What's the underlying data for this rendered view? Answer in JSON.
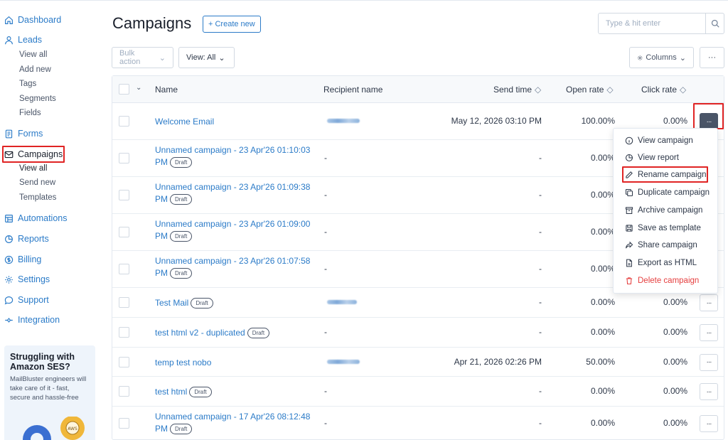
{
  "sidebar": {
    "nav": {
      "dashboard": "Dashboard",
      "leads": "Leads",
      "forms": "Forms",
      "campaigns": "Campaigns",
      "automations": "Automations",
      "reports": "Reports",
      "billing": "Billing",
      "settings": "Settings",
      "support": "Support",
      "integration": "Integration"
    },
    "leads_sub": [
      "View all",
      "Add new",
      "Tags",
      "Segments",
      "Fields"
    ],
    "campaigns_sub": [
      "View all",
      "Send new",
      "Templates"
    ],
    "promo": {
      "title": "Struggling with Amazon SES?",
      "text": "MailBluster engineers will take care of it - fast, secure and hassle-free",
      "badge": "AWS"
    }
  },
  "header": {
    "title": "Campaigns",
    "create_label": "+ Create new",
    "search_placeholder": "Type & hit enter"
  },
  "toolbar": {
    "bulk_action": "Bulk action",
    "view": "View: All",
    "columns": "Columns",
    "more": "···"
  },
  "table": {
    "headers": {
      "name": "Name",
      "recipient": "Recipient name",
      "send_time": "Send time",
      "open_rate": "Open rate",
      "click_rate": "Click rate"
    },
    "draft_label": "Draft",
    "rows": [
      {
        "name": "Welcome Email",
        "draft": false,
        "recipient": "",
        "send_time": "May 12, 2026 03:10 PM",
        "open_rate": "100.00%",
        "click_rate": "0.00%"
      },
      {
        "name": "Unnamed campaign - 23 Apr'26 01:10:03 PM",
        "draft": true,
        "recipient": "-",
        "send_time": "-",
        "open_rate": "0.00%",
        "click_rate": ""
      },
      {
        "name": "Unnamed campaign - 23 Apr'26 01:09:38 PM",
        "draft": true,
        "recipient": "-",
        "send_time": "-",
        "open_rate": "0.00%",
        "click_rate": ""
      },
      {
        "name": "Unnamed campaign - 23 Apr'26 01:09:00 PM",
        "draft": true,
        "recipient": "-",
        "send_time": "-",
        "open_rate": "0.00%",
        "click_rate": ""
      },
      {
        "name": "Unnamed campaign - 23 Apr'26 01:07:58 PM",
        "draft": true,
        "recipient": "-",
        "send_time": "-",
        "open_rate": "0.00%",
        "click_rate": ""
      },
      {
        "name": "Test Mail",
        "draft": true,
        "recipient": "",
        "send_time": "-",
        "open_rate": "0.00%",
        "click_rate": "0.00%"
      },
      {
        "name": "test html v2 - duplicated",
        "draft": true,
        "recipient": "-",
        "send_time": "-",
        "open_rate": "0.00%",
        "click_rate": "0.00%"
      },
      {
        "name": "temp test nobo",
        "draft": false,
        "recipient": "",
        "send_time": "Apr 21, 2026 02:26 PM",
        "open_rate": "50.00%",
        "click_rate": "0.00%"
      },
      {
        "name": "test html",
        "draft": true,
        "recipient": "-",
        "send_time": "-",
        "open_rate": "0.00%",
        "click_rate": "0.00%"
      },
      {
        "name": "Unnamed campaign - 17 Apr'26 08:12:48 PM",
        "draft": true,
        "recipient": "-",
        "send_time": "-",
        "open_rate": "0.00%",
        "click_rate": "0.00%"
      }
    ]
  },
  "menu": {
    "items": [
      {
        "label": "View campaign",
        "icon": "info-icon"
      },
      {
        "label": "View report",
        "icon": "report-icon"
      },
      {
        "label": "Rename campaign",
        "icon": "pencil-icon"
      },
      {
        "label": "Duplicate campaign",
        "icon": "copy-icon"
      },
      {
        "label": "Archive campaign",
        "icon": "archive-icon"
      },
      {
        "label": "Save as template",
        "icon": "save-icon"
      },
      {
        "label": "Share campaign",
        "icon": "share-icon"
      },
      {
        "label": "Export as HTML",
        "icon": "file-icon"
      },
      {
        "label": "Delete campaign",
        "icon": "trash-icon"
      }
    ]
  },
  "colors": {
    "accent": "#2b7bc8",
    "highlight": "#e02424",
    "danger": "#e53e3e"
  }
}
